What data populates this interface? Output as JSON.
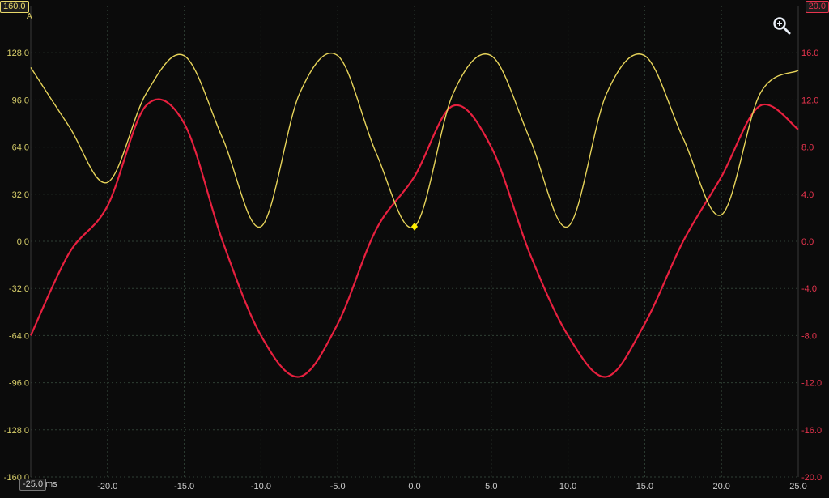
{
  "chart_data": {
    "type": "line",
    "x": [
      -25,
      -22.5,
      -20,
      -17.5,
      -15,
      -12.5,
      -10,
      -7.5,
      -5,
      -2.5,
      0,
      2.5,
      5,
      7.5,
      10,
      12.5,
      15,
      17.5,
      20,
      22.5,
      25
    ],
    "series": [
      {
        "values": [
          118,
          78,
          40,
          100,
          126,
          70,
          10,
          100,
          126,
          60,
          10,
          100,
          126,
          70,
          10,
          100,
          126,
          70,
          18,
          100,
          116
        ]
      },
      {
        "values": [
          -8,
          -1,
          3,
          11.5,
          10,
          0,
          -8,
          -11.5,
          -7,
          1,
          5.5,
          11.5,
          8,
          -1,
          -8,
          -11.5,
          -7,
          0,
          5.5,
          11.5,
          9.5
        ]
      }
    ],
    "xlim": [
      -25,
      25
    ],
    "ylim": [
      -160,
      160
    ],
    "y2lim": [
      -20,
      20
    ],
    "x_ticks": [
      "-25.0",
      "-20.0",
      "-15.0",
      "-10.0",
      "-5.0",
      "0.0",
      "5.0",
      "10.0",
      "15.0",
      "20.0",
      "25.0"
    ],
    "y_ticks": [
      "128.0",
      "96.0",
      "64.0",
      "32.0",
      "0.0",
      "-32.0",
      "-64.0",
      "-96.0",
      "-128.0",
      "-160.0"
    ],
    "y2_ticks": [
      "16.0",
      "12.0",
      "8.0",
      "4.0",
      "0.0",
      "-4.0",
      "-8.0",
      "-12.0",
      "-16.0",
      "-20.0"
    ],
    "grid": true,
    "colors": {
      "series1": "#e6d35a",
      "series2": "#e8203f",
      "grid": "#2f3f34",
      "marker": "#ffee00"
    }
  },
  "labels": {
    "y_top_tag": "160.0",
    "y_unit": "A",
    "y2_top_tag": "20.0",
    "x_start_tag": "-25.0",
    "x_unit": "ms",
    "zoom_icon": "zoom-in-icon"
  }
}
